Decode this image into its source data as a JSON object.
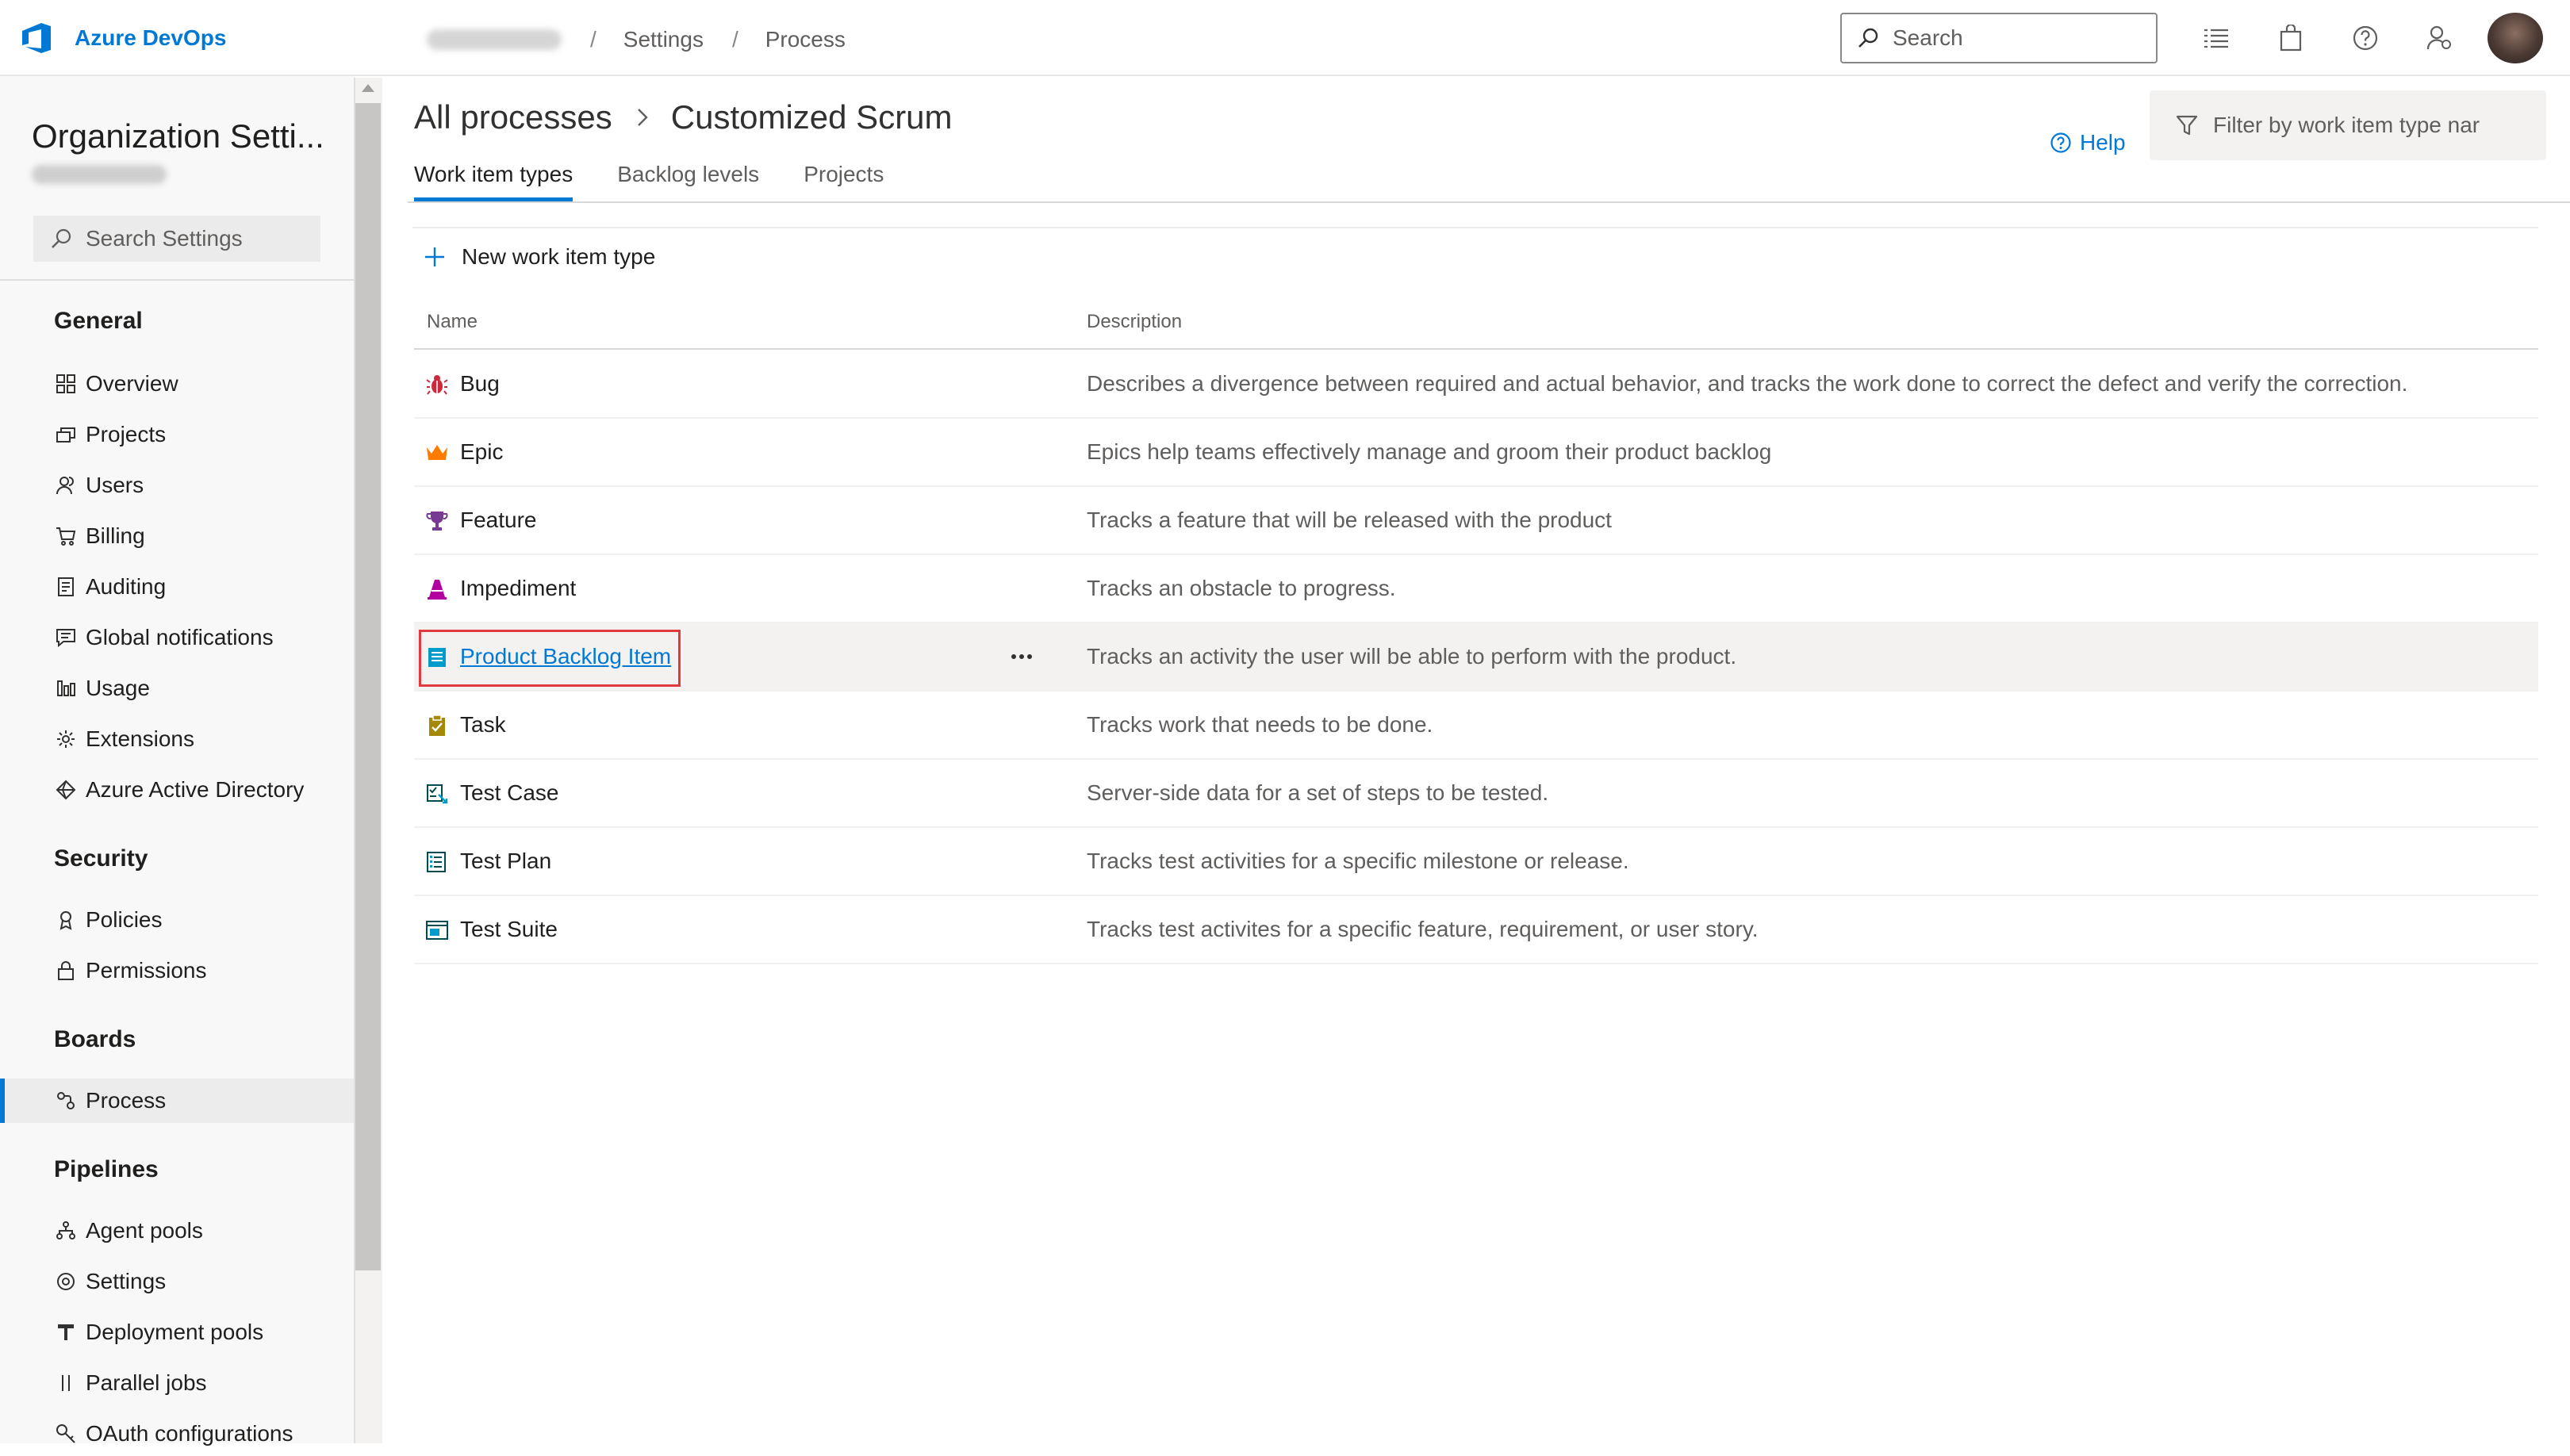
{
  "header": {
    "brand": "Azure DevOps",
    "breadcrumbs": [
      "Settings",
      "Process"
    ],
    "search_placeholder": "Search"
  },
  "sidebar": {
    "title": "Organization Setti...",
    "search_placeholder": "Search Settings",
    "groups": [
      {
        "label": "General",
        "items": [
          {
            "label": "Overview",
            "icon": "overview-icon"
          },
          {
            "label": "Projects",
            "icon": "projects-icon"
          },
          {
            "label": "Users",
            "icon": "users-icon"
          },
          {
            "label": "Billing",
            "icon": "cart-icon"
          },
          {
            "label": "Auditing",
            "icon": "audit-icon"
          },
          {
            "label": "Global notifications",
            "icon": "chat-icon"
          },
          {
            "label": "Usage",
            "icon": "bar-chart-icon"
          },
          {
            "label": "Extensions",
            "icon": "gear-icon"
          },
          {
            "label": "Azure Active Directory",
            "icon": "diamond-icon"
          }
        ]
      },
      {
        "label": "Security",
        "items": [
          {
            "label": "Policies",
            "icon": "policy-icon"
          },
          {
            "label": "Permissions",
            "icon": "lock-icon"
          }
        ]
      },
      {
        "label": "Boards",
        "items": [
          {
            "label": "Process",
            "icon": "process-icon",
            "selected": true
          }
        ]
      },
      {
        "label": "Pipelines",
        "items": [
          {
            "label": "Agent pools",
            "icon": "agent-pools-icon"
          },
          {
            "label": "Settings",
            "icon": "gear-icon"
          },
          {
            "label": "Deployment pools",
            "icon": "deployment-icon"
          },
          {
            "label": "Parallel jobs",
            "icon": "parallel-icon"
          },
          {
            "label": "OAuth configurations",
            "icon": "key-icon"
          }
        ]
      }
    ]
  },
  "main": {
    "breadcrumb_root": "All processes",
    "process_name": "Customized Scrum",
    "help_label": "Help",
    "filter_placeholder": "Filter by work item type nar",
    "tabs": [
      "Work item types",
      "Backlog levels",
      "Projects"
    ],
    "active_tab": "Work item types",
    "new_button": "New work item type",
    "columns": {
      "name": "Name",
      "description": "Description"
    },
    "rows": [
      {
        "name": "Bug",
        "icon": "bug-icon",
        "color": "#cc293d",
        "description": "Describes a divergence between required and actual behavior, and tracks the work done to correct the defect and verify the correction."
      },
      {
        "name": "Epic",
        "icon": "crown-icon",
        "color": "#ff7b00",
        "description": "Epics help teams effectively manage and groom their product backlog"
      },
      {
        "name": "Feature",
        "icon": "trophy-icon",
        "color": "#773b93",
        "description": "Tracks a feature that will be released with the product"
      },
      {
        "name": "Impediment",
        "icon": "impediment-icon",
        "color": "#b4009e",
        "description": "Tracks an obstacle to progress."
      },
      {
        "name": "Product Backlog Item",
        "icon": "backlog-item-icon",
        "color": "#009ccc",
        "description": "Tracks an activity the user will be able to perform with the product.",
        "highlighted": true
      },
      {
        "name": "Task",
        "icon": "clipboard-icon",
        "color": "#a4880a",
        "description": "Tracks work that needs to be done."
      },
      {
        "name": "Test Case",
        "icon": "test-case-icon",
        "color": "#004b50",
        "description": "Server-side data for a set of steps to be tested."
      },
      {
        "name": "Test Plan",
        "icon": "test-plan-icon",
        "color": "#004b50",
        "description": "Tracks test activities for a specific milestone or release."
      },
      {
        "name": "Test Suite",
        "icon": "test-suite-icon",
        "color": "#004b50",
        "description": "Tracks test activites for a specific feature, requirement, or user story."
      }
    ]
  },
  "colors": {
    "accent": "#0078d4",
    "highlight_border": "#e0393e"
  }
}
